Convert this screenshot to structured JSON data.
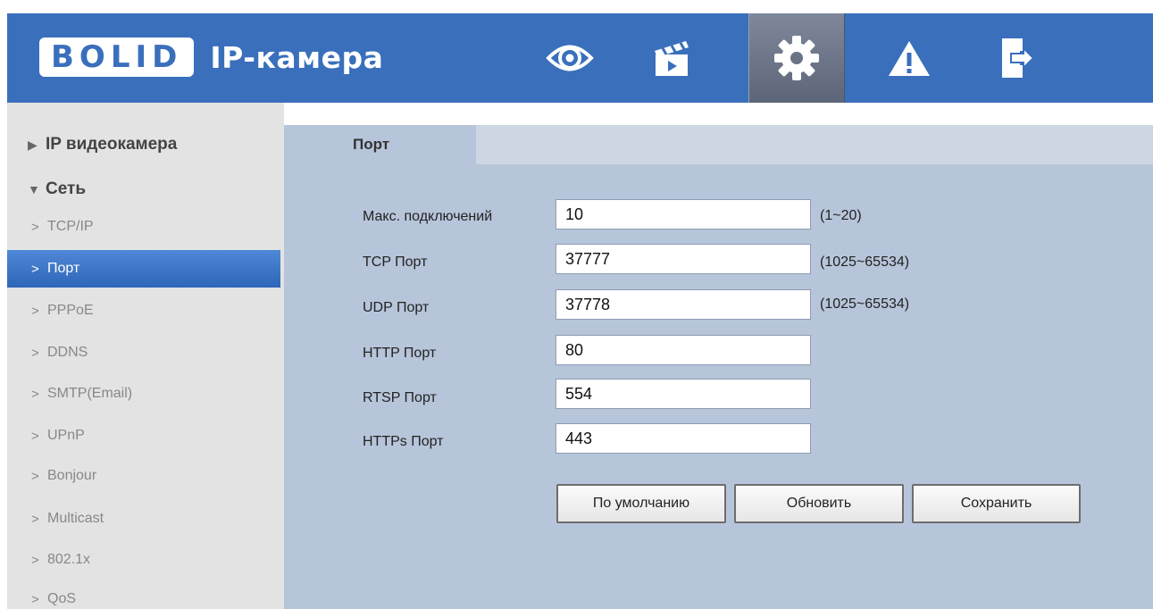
{
  "header": {
    "logo_text": "BOLID",
    "title": "IP-камера",
    "nav": [
      {
        "icon": "live-view-eye-icon"
      },
      {
        "icon": "playback-clapper-icon"
      },
      {
        "icon": "settings-gear-icon",
        "active": true
      },
      {
        "icon": "alarm-warning-icon"
      },
      {
        "icon": "logout-door-icon"
      }
    ]
  },
  "sidebar": {
    "groups": [
      {
        "label": "IP видеокамера",
        "expanded": false
      },
      {
        "label": "Сеть",
        "expanded": true
      }
    ],
    "items": [
      {
        "label": "TCP/IP"
      },
      {
        "label": "Порт",
        "active": true
      },
      {
        "label": "PPPoE"
      },
      {
        "label": "DDNS"
      },
      {
        "label": "SMTP(Email)"
      },
      {
        "label": "UPnP"
      },
      {
        "label": "Bonjour"
      },
      {
        "label": "Multicast"
      },
      {
        "label": "802.1x"
      },
      {
        "label": "QoS"
      }
    ]
  },
  "main": {
    "tab_label": "Порт",
    "fields": [
      {
        "label": "Макс. подключений",
        "value": "10",
        "range": "(1~20)"
      },
      {
        "label": "TCP Порт",
        "value": "37777",
        "range": "(1025~65534)"
      },
      {
        "label": "UDP Порт",
        "value": "37778",
        "range": "(1025~65534)"
      },
      {
        "label": "HTTP Порт",
        "value": "80",
        "range": ""
      },
      {
        "label": "RTSP Порт",
        "value": "554",
        "range": ""
      },
      {
        "label": "HTTPs Порт",
        "value": "443",
        "range": ""
      }
    ],
    "buttons": {
      "default": "По умолчанию",
      "refresh": "Обновить",
      "save": "Сохранить"
    }
  },
  "colors": {
    "header_bg": "#3a6fbc",
    "content_bg": "#b7c5da",
    "sidebar_bg": "#e3e3e3",
    "active_item": "#3b75c8"
  }
}
